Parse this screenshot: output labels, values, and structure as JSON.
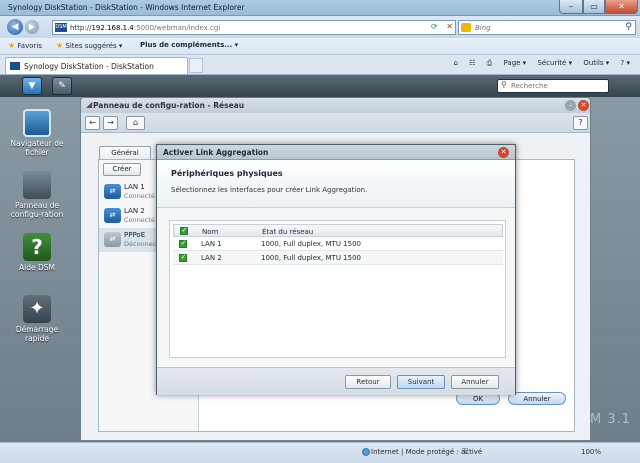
{
  "window": {
    "title": "Synology DiskStation - DiskStation - Windows Internet Explorer",
    "min": "–",
    "max": "▭",
    "close": "✕"
  },
  "address": {
    "url_prefix": "http://",
    "url_host": "192.168.1.4",
    "url_path": ":5000/webman/index.cgi",
    "favicon_text": "DSM",
    "search_placeholder": "Bing"
  },
  "favorites": {
    "favoris": "Favoris",
    "sites": "Sites suggérés ▾",
    "more": "Plus de compléments... ▾"
  },
  "tab": {
    "label": "Synology DiskStation - DiskStation"
  },
  "commandbar": {
    "page": "Page ▾",
    "security": "Sécurité ▾",
    "tools": "Outils ▾",
    "help": "? ▾"
  },
  "ds": {
    "search_placeholder": "Recherche",
    "desktop": [
      {
        "label": "Navigateur de fichier"
      },
      {
        "label": "Panneau de configu-ration"
      },
      {
        "label": "Aide DSM"
      },
      {
        "label": "Démarrage rapide"
      }
    ],
    "watermark": "M 3.1"
  },
  "control_panel": {
    "title": "Panneau de configu-ration - Réseau",
    "tab_general": "Général",
    "create": "Créer",
    "interfaces": [
      {
        "name": "LAN 1",
        "status": "Connecté"
      },
      {
        "name": "LAN 2",
        "status": "Connecté"
      },
      {
        "name": "PPPoE",
        "status": "Déconnecté"
      }
    ],
    "ok": "OK",
    "cancel": "Annuler"
  },
  "modal": {
    "title": "Activer Link Aggregation",
    "heading": "Périphériques physiques",
    "description": "Sélectionnez les interfaces pour créer Link Aggregation.",
    "columns": {
      "name": "Nom",
      "state": "État du réseau"
    },
    "rows": [
      {
        "name": "LAN 1",
        "state": "1000, Full duplex, MTU 1500",
        "checked": true
      },
      {
        "name": "LAN 2",
        "state": "1000, Full duplex, MTU 1500",
        "checked": true
      }
    ],
    "back": "Retour",
    "next": "Suivant",
    "cancel": "Annuler"
  },
  "status": {
    "zone": "Internet | Mode protégé : activé",
    "zoom": "100%"
  }
}
